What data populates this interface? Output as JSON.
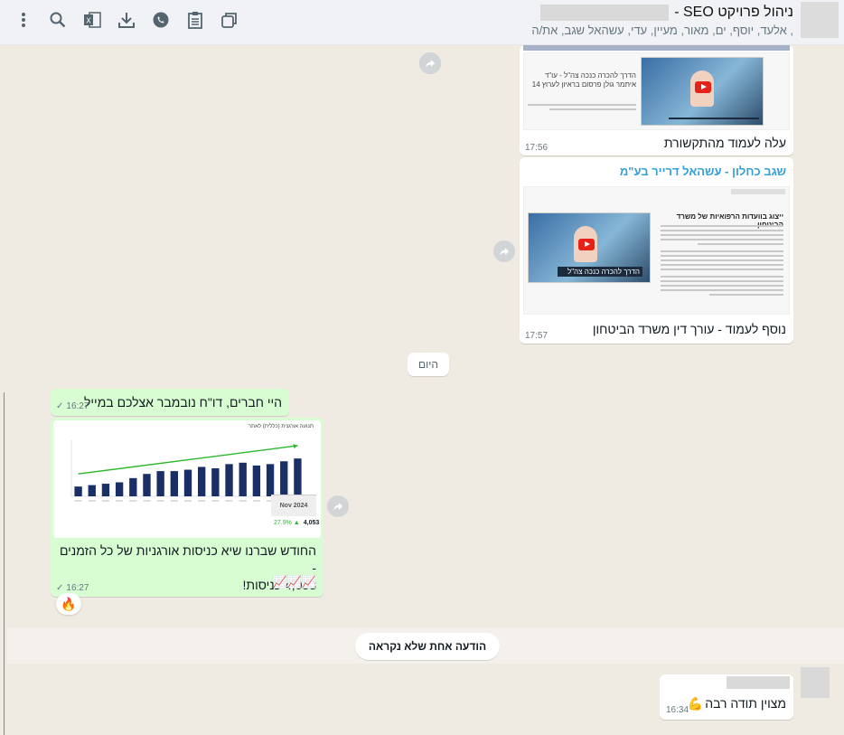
{
  "header": {
    "group_title": "ניהול פרויקט SEO -",
    "participants": ", אלעד, יוסף, ים, מאור, מעיין, עדי, עשהאל     שגב, את/ה"
  },
  "messages": [
    {
      "id": "m1",
      "preview_heading": "הדרך להכרה כנכה צה\"ל - עו\"ד איתמר גולן פרסום בראיון לערוץ 14",
      "text": "עלה לעמוד מהתקשורת",
      "time": "17:56"
    },
    {
      "id": "m2",
      "sender": "שגב כחלון - עשהאל דרייר בע\"מ",
      "preview_heading": "ייצוג בוועדות הרפואיות של משרד הביטחון",
      "video_caption": "הדרך להכרה כנכה צה\"ל",
      "text": "נוסף לעמוד - עורך דין משרד הביטחון",
      "time": "17:57"
    },
    {
      "id": "m3",
      "text": "היי חברים, דו\"ח נובמבר אצלכם במייל",
      "time": "16:27"
    },
    {
      "id": "m4",
      "chart_title": "תנועה אורגנית (כללית) לאתר",
      "chart_month": "Nov 2024",
      "chart_total": "4,053",
      "chart_change": "27.9% ▲",
      "text_line1": "החודש שברנו שיא כניסות אורגניות של כל הזמנים -",
      "text_line2": "4,053 כניסות!",
      "emoji": "📈📈📈",
      "time": "16:27",
      "reaction": "🔥"
    },
    {
      "id": "m5",
      "text": "מצוין תודה רבה",
      "emoji": "💪",
      "time": "16:34"
    }
  ],
  "date_separator": "היום",
  "unread_label": "הודעה אחת שלא נקראה",
  "chart_data": {
    "type": "bar",
    "title": "תנועה אורגנית (כללית) לאתר",
    "categories": [
      "",
      "",
      "",
      "",
      "",
      "",
      "",
      "",
      "",
      "",
      "",
      "",
      "",
      "",
      "",
      "",
      ""
    ],
    "values": [
      7,
      8,
      9,
      10,
      13,
      16,
      18,
      18,
      19,
      21,
      20,
      23,
      24,
      22,
      23,
      25,
      27
    ],
    "ylim": [
      0,
      40
    ],
    "grid": false,
    "legend": "none"
  },
  "colors": {
    "incoming_bubble": "#ffffff",
    "outgoing_bubble": "#d9fdd3",
    "bar_color": "#1a2f66",
    "trend_color": "#2eb82e",
    "background": "#efeae2"
  },
  "icons": [
    "more-vert-icon",
    "search-icon",
    "excel-icon",
    "download-icon",
    "whatsapp-icon",
    "clipboard-icon",
    "copy-windows-icon"
  ]
}
